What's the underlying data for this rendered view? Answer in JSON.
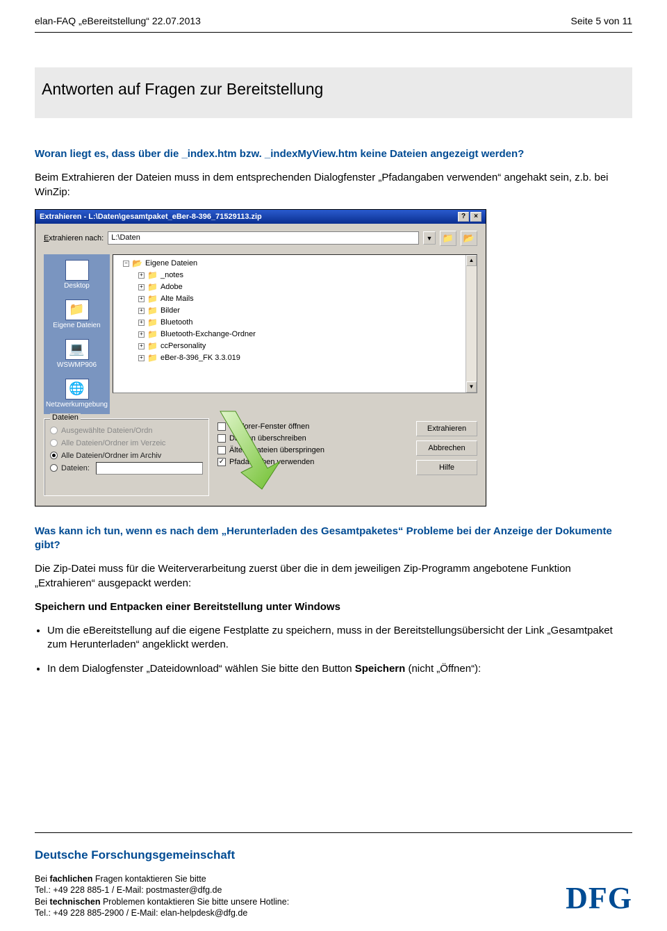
{
  "header": {
    "left": "elan-FAQ „eBereitstellung“ 22.07.2013",
    "right": "Seite 5 von 11"
  },
  "section_title": "Antworten auf Fragen zur Bereitstellung",
  "q1": {
    "heading": "Woran liegt es, dass über die _index.htm bzw. _indexMyView.htm keine Dateien angezeigt werden?",
    "para1": "Beim Extrahieren der Dateien muss in dem entsprechenden Dialogfenster „Pfadangaben verwenden“ angehakt sein, z.b. bei WinZip:"
  },
  "dialog": {
    "title": "Extrahieren - L:\\Daten\\gesamtpaket_eBer-8-396_71529113.zip",
    "extract_to_label": "Extrahieren nach:",
    "extract_to_value": "L:\\Daten",
    "sidebar": {
      "desktop": "Desktop",
      "eigene": "Eigene Dateien",
      "ws": "WSWMP906",
      "netz": "Netzwerkumgebung"
    },
    "tree": {
      "root": "Eigene Dateien",
      "items": [
        "_notes",
        "Adobe",
        "Alte Mails",
        "Bilder",
        "Bluetooth",
        "Bluetooth-Exchange-Ordner",
        "ccPersonality",
        "eBer-8-396_FK 3.3.019"
      ]
    },
    "fieldset_legend": "Dateien",
    "radios": {
      "r1": "Ausgewählte Dateien/Ordn",
      "r2": "Alle Dateien/Ordner im Verzeic",
      "r3": "Alle Dateien/Ordner im Archiv",
      "r4": "Dateien:"
    },
    "checks": {
      "c1": "Explorer-Fenster öffnen",
      "c2": "Dateien überschreiben",
      "c3": "Ältere Dateien überspringen",
      "c4": "Pfadangaben verwenden"
    },
    "buttons": {
      "extract": "Extrahieren",
      "cancel": "Abbrechen",
      "help": "Hilfe"
    }
  },
  "q2": {
    "heading": "Was kann ich tun, wenn es nach dem „Herunterladen des Gesamtpaketes“ Probleme bei der Anzeige der Dokumente gibt?",
    "para1": "Die Zip-Datei muss für die Weiterverarbeitung zuerst über die in dem jeweiligen Zip-Programm  angebotene Funktion „Extrahieren“ ausgepackt werden:",
    "para2_strong": "Speichern und Entpacken einer Bereitstellung unter Windows",
    "bullet1": "Um die eBereitstellung auf die eigene Festplatte zu speichern, muss in der Bereitstellungsübersicht der Link „Gesamtpaket zum Herunterladen“ angeklickt werden.",
    "bullet2_a": "In dem Dialogfenster „Dateidownload“ wählen Sie bitte den Button ",
    "bullet2_strong": "Speichern",
    "bullet2_b": " (nicht „Öffnen“):"
  },
  "footer": {
    "org": "Deutsche Forschungsgemeinschaft",
    "l1a": "Bei ",
    "l1b": "fachlichen",
    "l1c": " Fragen kontaktieren Sie bitte",
    "l2": "Tel.: +49 228 885-1 / E-Mail: postmaster@dfg.de",
    "l3a": "Bei ",
    "l3b": "technischen",
    "l3c": " Problemen kontaktieren Sie bitte unsere Hotline:",
    "l4": "Tel.: +49 228 885-2900 / E-Mail: elan-helpdesk@dfg.de",
    "logo": "DFG"
  }
}
